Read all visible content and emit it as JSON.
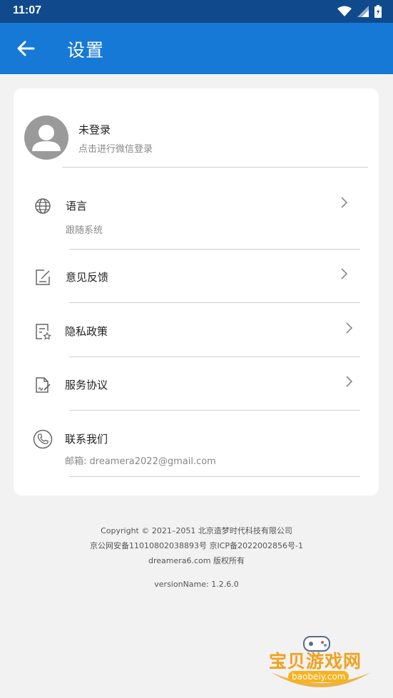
{
  "status_bar": {
    "time": "11:07"
  },
  "app_bar": {
    "title": "设置"
  },
  "account": {
    "title": "未登录",
    "subtitle": "点击进行微信登录"
  },
  "settings": {
    "language": {
      "label": "语言",
      "value": "跟随系统"
    },
    "feedback": {
      "label": "意见反馈"
    },
    "privacy": {
      "label": "隐私政策"
    },
    "service": {
      "label": "服务协议"
    },
    "contact": {
      "label": "联系我们",
      "value": "邮箱: dreamera2022@gmail.com"
    }
  },
  "footer": {
    "copyright": "Copyright © 2021–2051 北京造梦时代科技有限公司",
    "icp": "京公网安备11010802038893号 京ICP备2022002856号-1",
    "site": "dreamera6.com 版权所有",
    "version": "versionName: 1.2.6.0"
  },
  "watermark": {
    "text": "宝贝游戏网",
    "url": "baobeiy.com"
  },
  "colors": {
    "status_bar": "#104a8c",
    "app_bar": "#1679d6",
    "background": "#f2f2f2",
    "card": "#ffffff",
    "watermark": "#f2a11c"
  }
}
